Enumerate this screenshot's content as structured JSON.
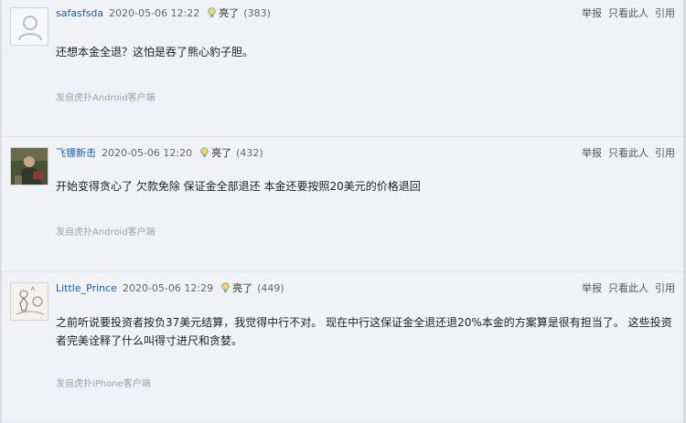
{
  "posts": [
    {
      "username": "safasfsda",
      "date": "2020-05-06 12:22",
      "light_label": "亮了",
      "light_count": "(383)",
      "actions": {
        "report": "举报",
        "only_this": "只看此人",
        "quote": "引用"
      },
      "content": "还想本金全退？这怕是吞了熊心豹子胆。",
      "source": "发自虎扑Android客户端",
      "avatar": "default-avatar"
    },
    {
      "username": "飞镖新击",
      "date": "2020-05-06 12:20",
      "light_label": "亮了",
      "light_count": "(432)",
      "actions": {
        "report": "举报",
        "only_this": "只看此人",
        "quote": "引用"
      },
      "content": "开始变得贪心了 欠款免除 保证金全部退还 本金还要按照20美元的价格退回",
      "source": "发自虎扑Android客户端",
      "avatar": "photo-avatar"
    },
    {
      "username": "Little_Prince",
      "date": "2020-05-06 12:29",
      "light_label": "亮了",
      "light_count": "(449)",
      "actions": {
        "report": "举报",
        "only_this": "只看此人",
        "quote": "引用"
      },
      "content": "之前听说要投资者按负37美元结算，我觉得中行不对。 现在中行这保证金全退还退20%本金的方案算是很有担当了。 这些投资者完美诠释了什么叫得寸进尺和贪婪。",
      "source": "发自虎扑iPhone客户端",
      "avatar": "sketch-avatar"
    }
  ],
  "colors": {
    "username": "#1a5ea8",
    "background": "#f1f2f5",
    "source": "#9aa0a8"
  }
}
